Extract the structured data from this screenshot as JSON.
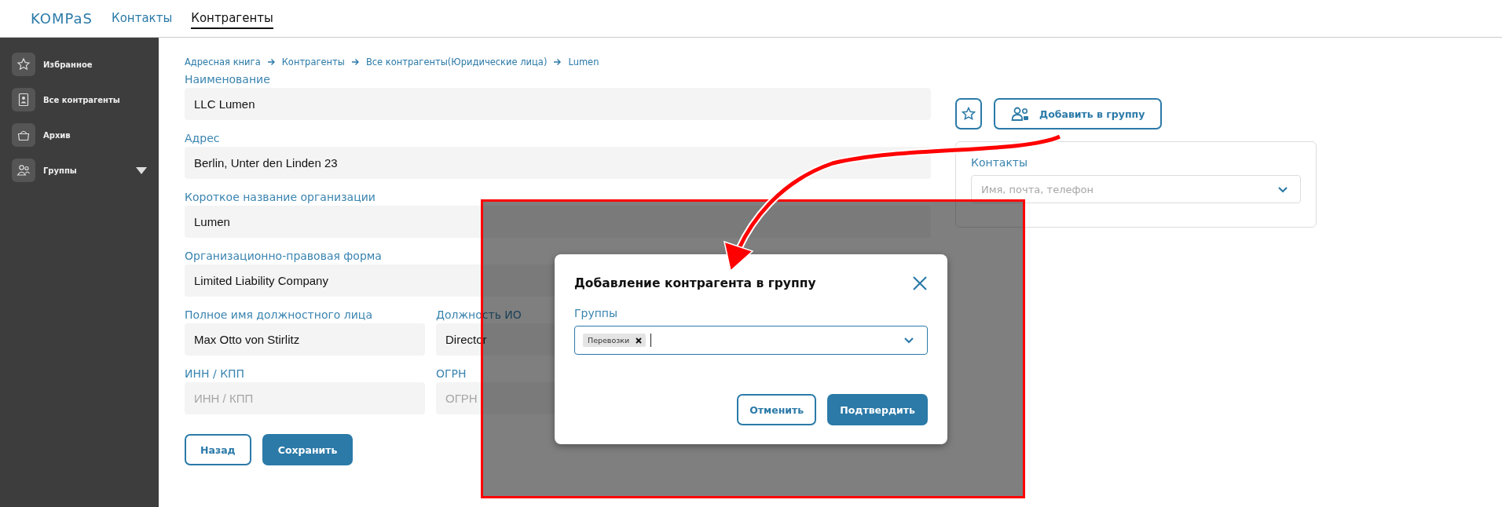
{
  "header": {
    "logo": "KOMPaS",
    "tabs": [
      {
        "label": "Контакты",
        "selected": false
      },
      {
        "label": "Контрагенты",
        "selected": true
      }
    ]
  },
  "sidebar": {
    "items": [
      {
        "label": "Избранное"
      },
      {
        "label": "Все контрагенты"
      },
      {
        "label": "Архив"
      },
      {
        "label": "Группы",
        "expanded": false
      }
    ]
  },
  "breadcrumb": [
    "Адресная книга",
    "Контрагенты",
    "Все контрагенты(Юридические лица)",
    "Lumen"
  ],
  "form": {
    "fields": [
      {
        "label": "Наименование",
        "value": "LLC Lumen",
        "kind": "full"
      },
      {
        "label": "Адрес",
        "value": "Berlin, Unter den Linden 23",
        "kind": "full"
      },
      {
        "label": "Короткое название организации",
        "value": "Lumen",
        "kind": "full"
      },
      {
        "label": "Организационно-правовая форма",
        "value": "Limited Liability Company",
        "kind": "full"
      },
      {
        "label": "Полное имя должностного лица",
        "value": "Max Otto von Stirlitz",
        "kind": "half"
      },
      {
        "label": "Должность ИО",
        "value": "Director",
        "kind": "half"
      },
      {
        "label": "ИНН / КПП",
        "placeholder": "ИНН / КПП",
        "kind": "half"
      },
      {
        "label": "ОГРН",
        "placeholder": "ОГРН",
        "kind": "half"
      }
    ],
    "buttons": [
      {
        "label": "Назад",
        "kind": "secondary"
      },
      {
        "label": "Сохранить",
        "kind": "primary"
      }
    ]
  },
  "side": {
    "favorite": false,
    "add_button": "Добавить в группу",
    "contacts": {
      "label": "Контакты",
      "placeholder": "Имя, почта, телефон"
    }
  },
  "dialog": {
    "title": "Добавление контрагента в группу",
    "field_label": "Группы",
    "tags": [
      {
        "label": "Перевозки"
      }
    ],
    "buttons": [
      {
        "label": "Отменить",
        "kind": "secondary"
      },
      {
        "label": "Подтвердить",
        "kind": "primary"
      }
    ]
  },
  "annotations": {
    "highlight_frame": true,
    "arrow": true
  }
}
